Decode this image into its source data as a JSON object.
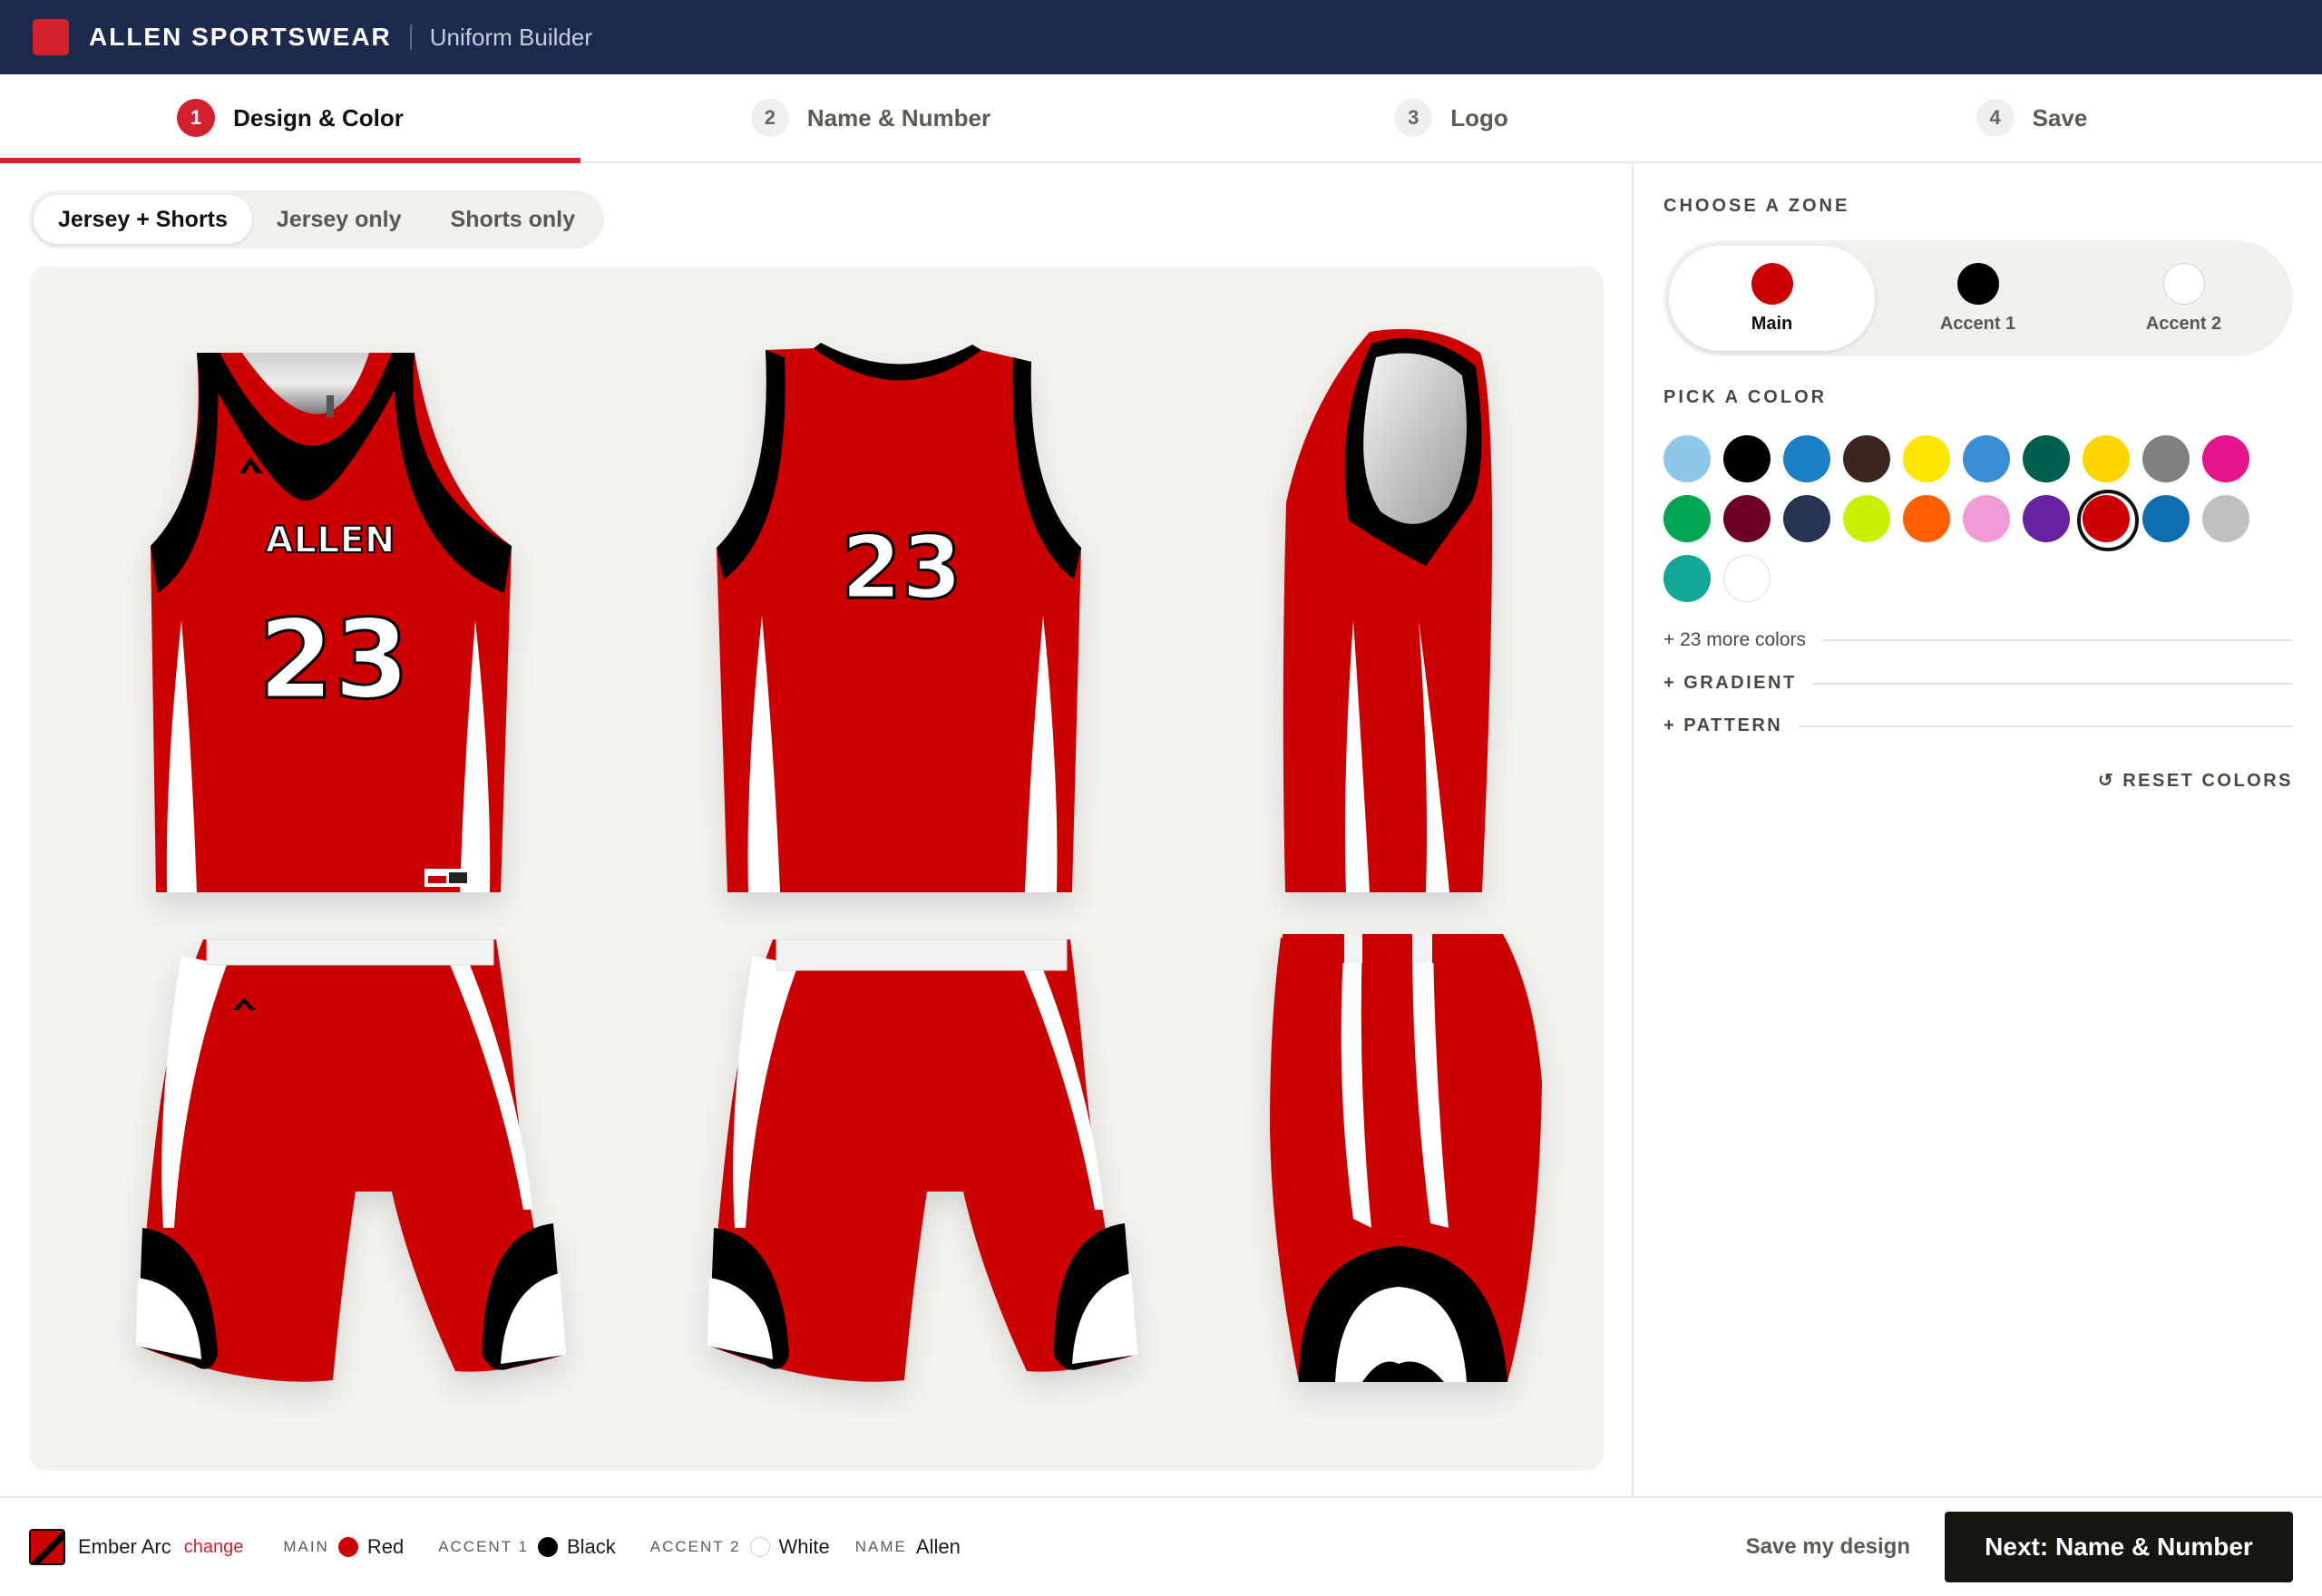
{
  "header": {
    "brand": "ALLEN SPORTSWEAR",
    "subtitle": "Uniform Builder",
    "accent": "#d3212d",
    "bg": "#1c2a4d"
  },
  "steps": [
    {
      "num": "1",
      "label": "Design & Color",
      "active": true
    },
    {
      "num": "2",
      "label": "Name & Number",
      "active": false
    },
    {
      "num": "3",
      "label": "Logo",
      "active": false
    },
    {
      "num": "4",
      "label": "Save",
      "active": false
    }
  ],
  "views": [
    {
      "label": "Jersey + Shorts",
      "active": true
    },
    {
      "label": "Jersey only",
      "active": false
    },
    {
      "label": "Shorts only",
      "active": false
    }
  ],
  "preview": {
    "jersey_text": "ALLEN",
    "number": "23",
    "colors": {
      "main": "#cc0000",
      "accent1": "#000000",
      "accent2": "#ffffff"
    }
  },
  "panel": {
    "zone_title": "CHOOSE A ZONE",
    "zones": [
      {
        "label": "Main",
        "color": "#cc0000",
        "active": true
      },
      {
        "label": "Accent 1",
        "color": "#000000",
        "active": false
      },
      {
        "label": "Accent 2",
        "color": "#ffffff",
        "active": false
      }
    ],
    "color_title": "PICK A COLOR",
    "swatches": [
      "#8ec8e8",
      "#000000",
      "#1a7fc4",
      "#3d2620",
      "#ffe600",
      "#3a8fd4",
      "#005f4f",
      "#ffd500",
      "#808080",
      "#e6148c",
      "#00a651",
      "#6e0026",
      "#253551",
      "#c8f000",
      "#ff5f00",
      "#f29ad8",
      "#6622a0",
      "#cc0000",
      "#0f6eb0",
      "#c0c0c0",
      "#12a796",
      "#ffffff"
    ],
    "selected_swatch_index": 17,
    "more_colors": "+ 23 more colors",
    "gradient": "+ GRADIENT",
    "pattern": "+ PATTERN",
    "reset": "↺ RESET COLORS"
  },
  "footer": {
    "design_name": "Ember Arc",
    "change": "change",
    "specs": [
      {
        "label": "MAIN",
        "value": "Red",
        "color": "#cc0000"
      },
      {
        "label": "ACCENT 1",
        "value": "Black",
        "color": "#000000"
      },
      {
        "label": "ACCENT 2",
        "value": "White",
        "color": "#ffffff"
      }
    ],
    "name_label": "NAME",
    "name_value": "Allen",
    "save": "Save my design",
    "next": "Next: Name & Number"
  }
}
